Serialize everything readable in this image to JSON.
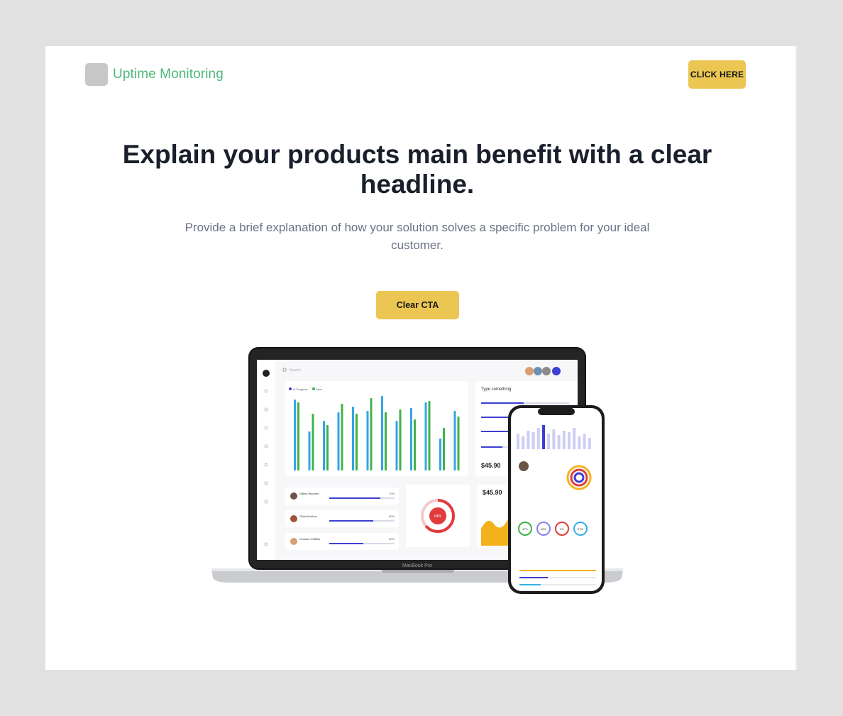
{
  "header": {
    "logo_text": "Uptime Monitoring",
    "cta_label": "CLICK HERE"
  },
  "hero": {
    "headline": "Explain your products main benefit with a clear headline.",
    "subheadline": "Provide a brief explanation of how your solution solves a specific problem for your ideal customer.",
    "cta_label": "Clear CTA"
  },
  "mockup": {
    "laptop_label": "MacBook Pro",
    "search_placeholder": "Search",
    "legend": [
      "In Progress",
      "New"
    ],
    "panel_title": "Type something",
    "price": "$45.90",
    "progress_percent": "64%",
    "people": [
      {
        "name": "Halina Bloomer",
        "value": "70%"
      },
      {
        "name": "Olivia Armbus",
        "value": "60%"
      },
      {
        "name": "Graham Griffiths",
        "value": "50%"
      }
    ],
    "phone_metrics": [
      "47%",
      "48%",
      "9%",
      "67%"
    ]
  },
  "colors": {
    "brand_green": "#4fb87a",
    "cta_yellow": "#ebc653",
    "headline": "#1a1f2c",
    "body_text": "#6a7385"
  }
}
